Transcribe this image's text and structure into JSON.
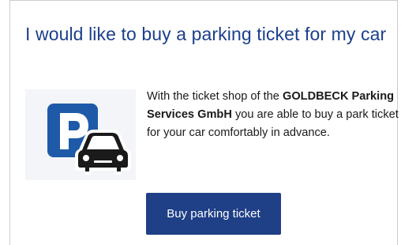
{
  "card": {
    "title": "I would like to buy a parking ticket for my car",
    "description": {
      "part1": "With the ticket shop of the ",
      "company": "GOLDBECK Parking Services GmbH",
      "part2": " you are able to buy a park ticket for your car comfortably in advance."
    },
    "icon": "parking-car-icon",
    "button_label": "Buy parking ticket"
  },
  "colors": {
    "title": "#1b3f8b",
    "button_bg": "#1f3f87",
    "button_text": "#ffffff",
    "parking_sign": "#1e5aa8",
    "car": "#1a1a1a"
  }
}
